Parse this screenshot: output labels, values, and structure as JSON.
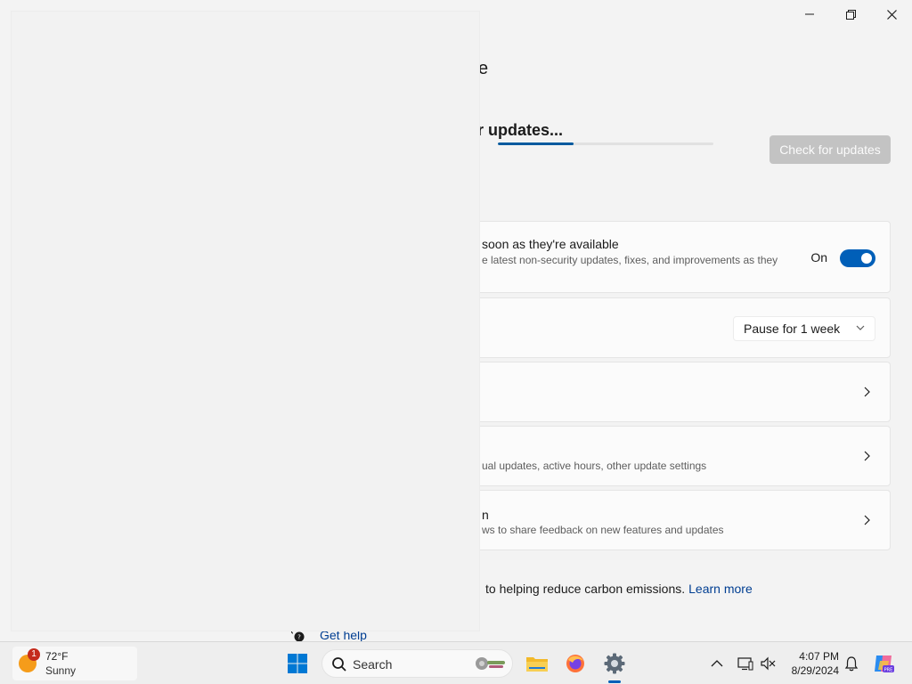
{
  "window": {
    "minimize_icon": "minimize-icon",
    "maximize_icon": "restore-icon",
    "close_icon": "close-icon"
  },
  "page": {
    "title_partial": "e",
    "status_title": "r updates...",
    "check_button_label": "Check for updates",
    "progress_fraction": 0.35
  },
  "cards": {
    "latest_updates": {
      "title": "soon as they're available",
      "subtitle": "e latest non-security updates, fixes, and improvements as they",
      "toggle_label": "On",
      "toggle_on": true
    },
    "pause_updates": {
      "select_value": "Pause for 1 week"
    },
    "update_history": {},
    "advanced_options": {
      "subtitle": "ual updates, active hours, other update settings"
    },
    "insider_program": {
      "title": "n",
      "subtitle": "ws to share feedback on new features and updates"
    }
  },
  "footer": {
    "text": "to helping reduce carbon emissions.",
    "link": "Learn more",
    "help_link": "Get help"
  },
  "taskbar": {
    "weather": {
      "badge": "1",
      "temp": "72°F",
      "condition": "Sunny"
    },
    "search_placeholder": "Search",
    "clock_time": "4:07 PM",
    "clock_date": "8/29/2024",
    "colors": {
      "accent": "#005fb8",
      "link": "#003e92"
    }
  }
}
